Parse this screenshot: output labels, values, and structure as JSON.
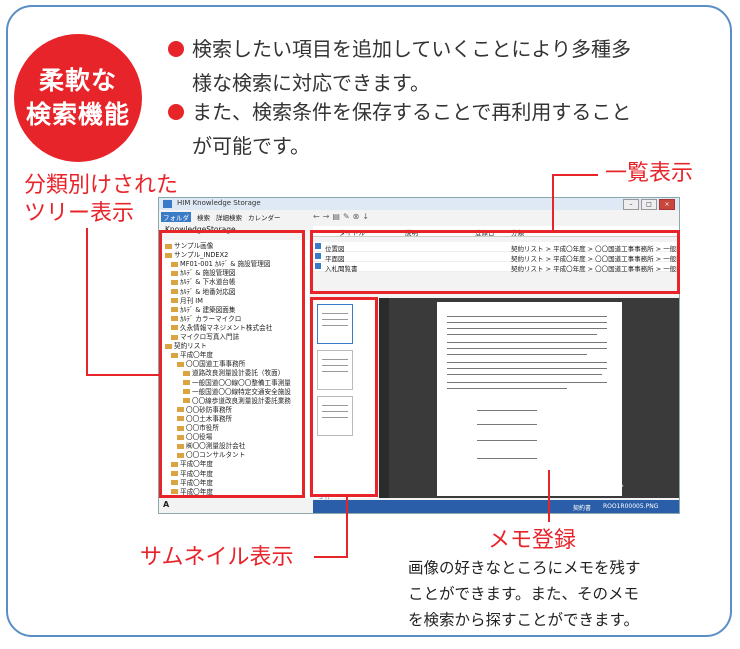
{
  "badge": {
    "line1": "柔軟な",
    "line2": "検索機能"
  },
  "bullets": {
    "b1_line1": "検索したい項目を追加していくことにより多種多",
    "b1_line2": "様な検索に対応できます。",
    "b2_line1": "また、検索条件を保存することで再利用すること",
    "b2_line2": "が可能です。"
  },
  "labels": {
    "tree_line1": "分類別けされた",
    "tree_line2": "ツリー表示",
    "list": "一覧表示",
    "thumbnail": "サムネイル表示",
    "memo": "メモ登録"
  },
  "memo_desc": {
    "line1": "画像の好きなところにメモを残す",
    "line2": "ことができます。また、そのメモ",
    "line3": "を検索から探すことができます。"
  },
  "app": {
    "title": "HIM Knowledge Storage",
    "tabs": {
      "folder": "フォルダ",
      "search": "検索",
      "detail": "詳細検索",
      "calendar": "カレンダー"
    },
    "root": "KnowledgeStorage",
    "tree": [
      "サンプル画像",
      "サンプル_INDEX2",
      "MF01-001 ｶﾙﾃﾞ & 施設管理図",
      "ｶﾙﾃﾞ & 施設管理図",
      "ｶﾙﾃﾞ & 下水道台帳",
      "ｶﾙﾃﾞ & 地番対応図",
      "月刊 IM",
      "ｶﾙﾃﾞ & 建築図面集",
      "ｶﾙﾃﾞ カラーマイクロ",
      "久永情報マネジメント株式会社",
      "マイクロ写真入門誌",
      "契約リスト",
      "平成〇年度",
      "〇〇国道工事事務所",
      "道路改良測量設計委託（牧面）",
      "一般国道〇〇線〇〇整備工事測量",
      "一般国道〇〇線特定交通安全施設",
      "〇〇線歩道改良測量設計委託業務",
      "〇〇砂防事務所",
      "〇〇土木事務所",
      "〇〇市役所",
      "〇〇役場",
      "㈱〇〇測量設計会社",
      "〇〇コンサルタント",
      "平成〇年度",
      "平成〇年度",
      "平成〇年度",
      "平成〇年度"
    ],
    "font_button": "A",
    "list_headers": {
      "title": "タイトル",
      "desc": "説明",
      "date": "登録日",
      "category": "分類"
    },
    "rows": [
      {
        "title": "位置図",
        "category": "契約リスト > 平成〇年度 > 〇〇国道工事事務所 > 一般国"
      },
      {
        "title": "平面図",
        "category": "契約リスト > 平成〇年度 > 〇〇国道工事事務所 > 一般国"
      },
      {
        "title": "入札聞覧書",
        "category": "契約リスト > 平成〇年度 > 〇〇国道工事事務所 > 一般国"
      }
    ],
    "page_count": "3 件",
    "zoom": "47 %",
    "status_left": "契約書",
    "status_file": "ROO1R00005.PNG"
  }
}
